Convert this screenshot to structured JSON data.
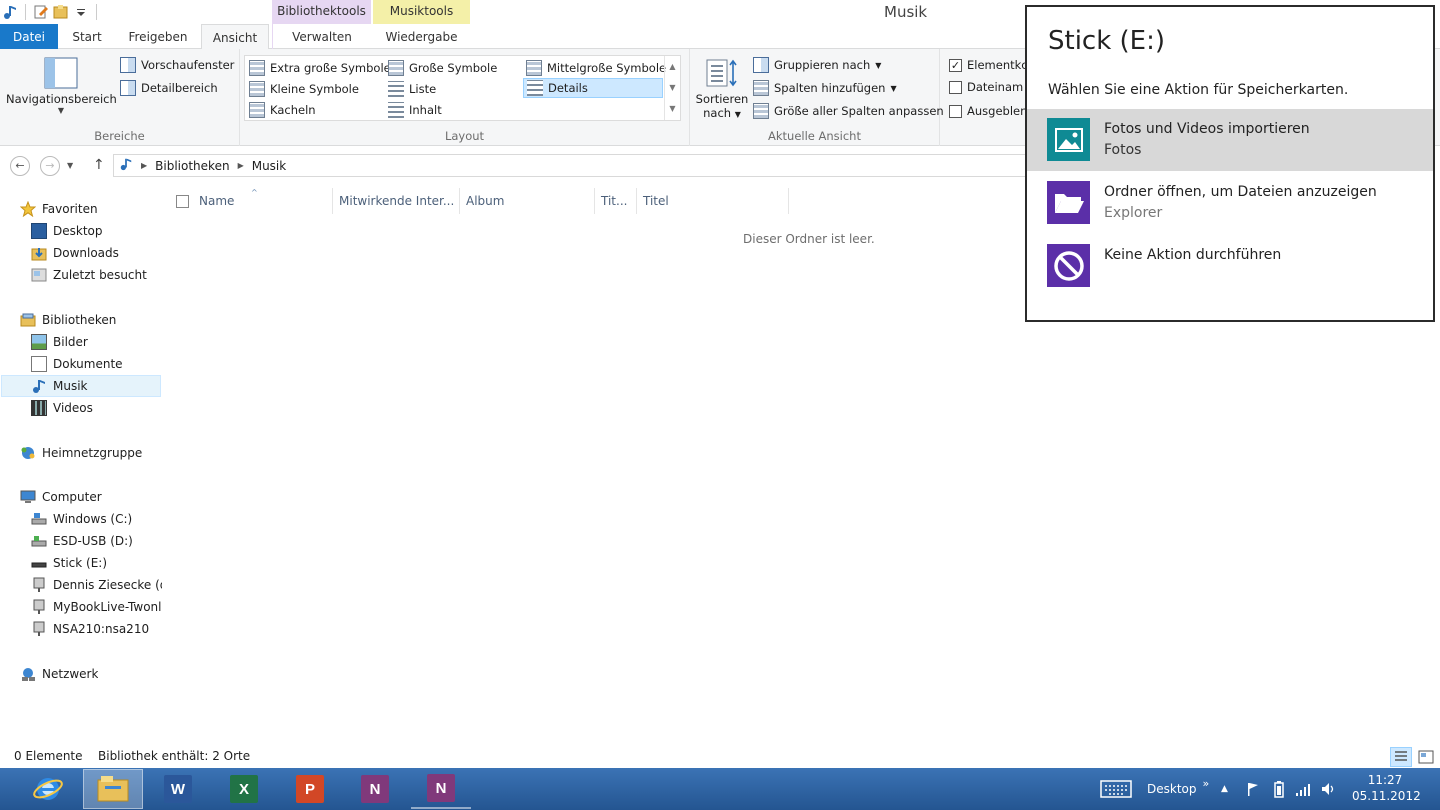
{
  "window": {
    "title": "Musik",
    "context_tabs": {
      "bibliothek": "Bibliothektools",
      "musik": "Musiktools"
    }
  },
  "tabs": {
    "file": "Datei",
    "start": "Start",
    "share": "Freigeben",
    "view": "Ansicht",
    "manage": "Verwalten",
    "playback": "Wiedergabe"
  },
  "ribbon": {
    "panes": {
      "nav_label": "Navigationsbereich",
      "preview": "Vorschaufenster",
      "details": "Detailbereich",
      "group_label": "Bereiche"
    },
    "layout": {
      "extra_large": "Extra große Symbole",
      "large": "Große Symbole",
      "medium": "Mittelgroße Symbole",
      "small": "Kleine Symbole",
      "list": "Liste",
      "details": "Details",
      "tiles": "Kacheln",
      "content": "Inhalt",
      "group_label": "Layout"
    },
    "current_view": {
      "sort_label_1": "Sortieren",
      "sort_label_2": "nach",
      "group_by": "Gruppieren nach",
      "add_columns": "Spalten hinzufügen",
      "size_columns": "Größe aller Spalten anpassen",
      "group_label": "Aktuelle Ansicht"
    },
    "show_hide": {
      "item_checkboxes": "Elementkc",
      "file_extensions": "Dateinam",
      "hidden_items": "Ausgeblen"
    }
  },
  "address": {
    "crumbs": [
      "Bibliotheken",
      "Musik"
    ]
  },
  "nav": {
    "favorites": "Favoriten",
    "desktop": "Desktop",
    "downloads": "Downloads",
    "recent": "Zuletzt besucht",
    "libraries": "Bibliotheken",
    "pictures": "Bilder",
    "documents": "Dokumente",
    "music": "Musik",
    "videos": "Videos",
    "homegroup": "Heimnetzgruppe",
    "computer": "Computer",
    "drive_c": "Windows (C:)",
    "drive_d": "ESD-USB (D:)",
    "drive_e": "Stick (E:)",
    "net_1": "Dennis Ziesecke (de",
    "net_2": "MyBookLive-Twonl",
    "net_3": "NSA210:nsa210",
    "network": "Netzwerk"
  },
  "content": {
    "columns": [
      "Name",
      "Mitwirkende Inter...",
      "Album",
      "Tit...",
      "Titel"
    ],
    "empty_message": "Dieser Ordner ist leer."
  },
  "status": {
    "count": "0 Elemente",
    "library_info": "Bibliothek enthält: 2 Orte"
  },
  "taskbar": {
    "desktop_label": "Desktop",
    "time": "11:27",
    "date": "05.11.2012",
    "apps": {
      "word": "W",
      "excel": "X",
      "powerpoint": "P",
      "onenote": "N",
      "onenote_clip": "N"
    }
  },
  "toast": {
    "title": "Stick (E:)",
    "subtitle": "Wählen Sie eine Aktion für Speicherkarten.",
    "options": [
      {
        "main": "Fotos und Videos importieren",
        "sub": "Fotos",
        "color": "#0f8a94"
      },
      {
        "main": "Ordner öffnen, um Dateien anzuzeigen",
        "sub": "Explorer",
        "color": "#5b2fa8"
      },
      {
        "main": "Keine Aktion durchführen",
        "sub": "",
        "color": "#5b2fa8"
      }
    ]
  },
  "colors": {
    "file_tab": "#1979ca",
    "taskbar": "#2a5fa0",
    "bibliothek_tab": "#e6d7f2",
    "musik_tab": "#f4f0a8"
  }
}
